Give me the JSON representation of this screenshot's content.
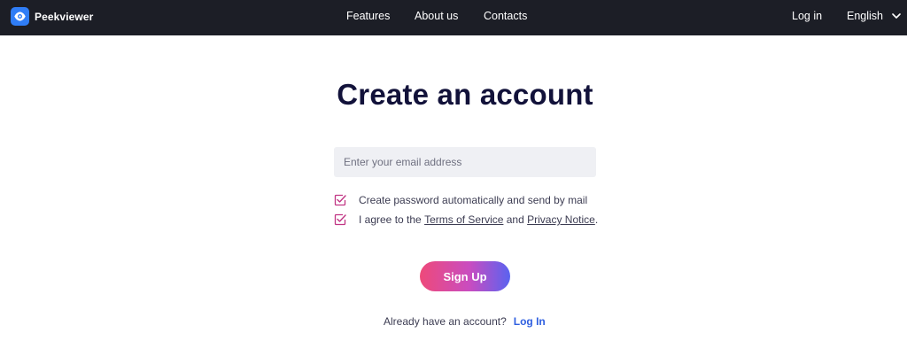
{
  "brand": {
    "name": "Peekviewer",
    "logo_icon": "eye-icon",
    "logo_color": "#2f7df6"
  },
  "nav": {
    "features": "Features",
    "about": "About us",
    "contacts": "Contacts",
    "login": "Log in",
    "language": "English"
  },
  "signup": {
    "title": "Create an account",
    "email_placeholder": "Enter your email address",
    "email_value": "",
    "option_auto_password": "Create password automatically and send by mail",
    "agree_prefix": "I agree to the ",
    "terms": "Terms of Service",
    "and": " and ",
    "privacy": "Privacy Notice",
    "period": ".",
    "button": "Sign Up",
    "already_text": "Already have an account?",
    "login_link": "Log In"
  },
  "colors": {
    "navbar_bg": "#1c1e26",
    "checkbox": "#c13584",
    "link": "#2f5fe0",
    "gradient_start": "#ee4a7a",
    "gradient_end": "#5a63f0"
  }
}
